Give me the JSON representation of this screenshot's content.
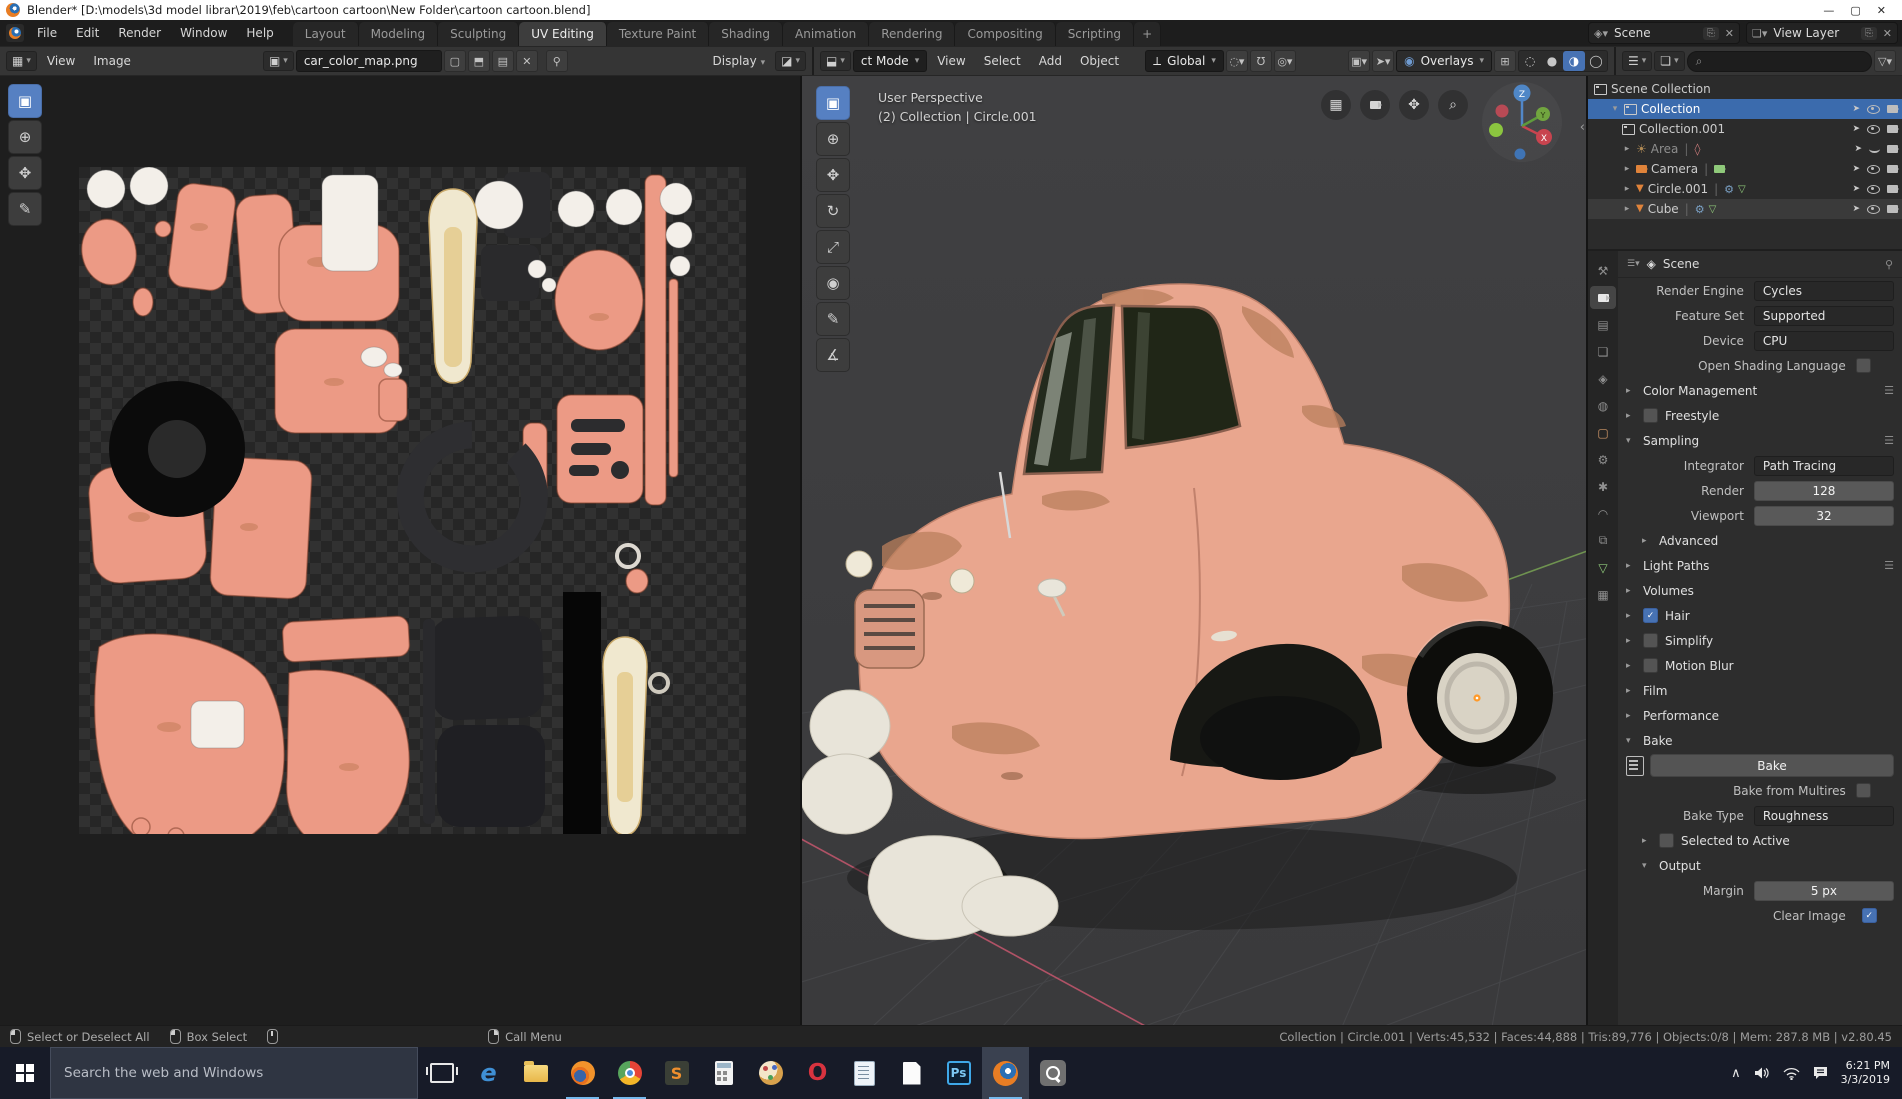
{
  "colors": {
    "accent_blue": "#4772b3",
    "selection_blue": "#3b6bad",
    "active_tool_blue": "#5680c2",
    "car_body_salmon": "#e9a68e",
    "uv_island_salmon": "#ec9a85",
    "taskbar_underline_blue": "#76b9ed",
    "blender_orange": "#e87d24"
  },
  "titlebar": {
    "title": "Blender* [D:\\models\\3d model librar\\2019\\feb\\cartoon cartoon\\New Folder\\cartoon cartoon.blend]",
    "minimize": "—",
    "maximize": "▢",
    "close": "✕"
  },
  "topbar": {
    "menus": [
      "File",
      "Edit",
      "Render",
      "Window",
      "Help"
    ],
    "tabs": [
      "Layout",
      "Modeling",
      "Sculpting",
      "UV Editing",
      "Texture Paint",
      "Shading",
      "Animation",
      "Rendering",
      "Compositing",
      "Scripting"
    ],
    "active_tab": "UV Editing",
    "plus_tab": "+",
    "scene_selector": {
      "label": "Scene"
    },
    "view_layer_selector": {
      "label": "View Layer"
    }
  },
  "uv_editor": {
    "menus": [
      "View",
      "Image"
    ],
    "image_name": "car_color_map.png",
    "display_label": "Display"
  },
  "viewport": {
    "mode_label": "ct Mode",
    "menus": [
      "View",
      "Select",
      "Add",
      "Object"
    ],
    "orientation_label": "Global",
    "overlays_label": "Overlays",
    "overlay_line1": "User Perspective",
    "overlay_line2": "(2) Collection | Circle.001",
    "gizmo_axes": {
      "x": "X",
      "y": "Y",
      "z": "Z"
    }
  },
  "outliner": {
    "rows": [
      {
        "label": "Scene Collection"
      },
      {
        "label": "Collection",
        "selected": true
      },
      {
        "label": "Collection.001"
      },
      {
        "label": "Area",
        "dim": true,
        "eye_closed": true
      },
      {
        "label": "Camera"
      },
      {
        "label": "Circle.001"
      },
      {
        "label": "Cube",
        "active": true
      }
    ]
  },
  "properties": {
    "breadcrumb": "Scene",
    "rows": [
      {
        "label": "Render Engine",
        "value": "Cycles"
      },
      {
        "label": "Feature Set",
        "value": "Supported"
      },
      {
        "label": "Device",
        "value": "CPU"
      },
      {
        "label": "Open Shading Language",
        "checked": false
      },
      {
        "label": "Color Management"
      },
      {
        "label": "Freestyle",
        "checked": false
      },
      {
        "label": "Sampling"
      },
      {
        "label": "Integrator",
        "value": "Path Tracing"
      },
      {
        "label": "Render",
        "value": "128"
      },
      {
        "label": "Viewport",
        "value": "32"
      },
      {
        "label": "Advanced"
      },
      {
        "label": "Light Paths"
      },
      {
        "label": "Volumes"
      },
      {
        "label": "Hair",
        "checked": true
      },
      {
        "label": "Simplify",
        "checked": false
      },
      {
        "label": "Motion Blur",
        "checked": false
      },
      {
        "label": "Film"
      },
      {
        "label": "Performance"
      },
      {
        "label": "Bake"
      },
      {
        "label": "Bake"
      },
      {
        "label": "Bake from Multires",
        "checked": false
      },
      {
        "label": "Bake Type",
        "value": "Roughness"
      },
      {
        "label": "Selected to Active",
        "checked": false
      },
      {
        "label": "Output"
      },
      {
        "label": "Margin",
        "value": "5 px"
      },
      {
        "label": "Clear Image",
        "checked": true
      }
    ]
  },
  "statusbar": {
    "hints": [
      "Select or Deselect All",
      "Box Select",
      "Call Menu"
    ],
    "stats": "Collection | Circle.001 | Verts:45,532 | Faces:44,888 | Tris:89,776 | Objects:0/8 | Mem: 287.8 MB | v2.80.45"
  },
  "taskbar": {
    "search_placeholder": "Search the web and Windows",
    "photoshop_label": "Ps",
    "tray": {
      "time": "6:21 PM",
      "date": "3/3/2019"
    }
  }
}
